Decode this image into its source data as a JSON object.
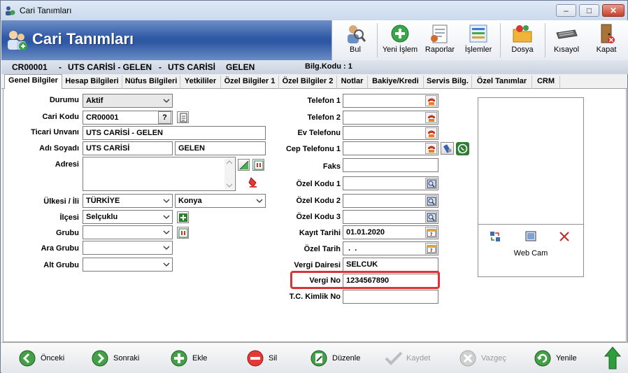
{
  "window": {
    "title": "Cari Tanımları"
  },
  "header": {
    "title": "Cari Tanımları"
  },
  "toolbar": {
    "bul": "Bul",
    "yeni_islem": "Yeni İşlem",
    "raporlar": "Raporlar",
    "islemler": "İşlemler",
    "dosya": "Dosya",
    "kisayol": "Kısayol",
    "kapat": "Kapat"
  },
  "infobar": {
    "code": "CR00001",
    "sep1": "-",
    "name1": "UTS CARİSİ - GELEN",
    "sep2": "-",
    "name2": "UTS CARİSİ",
    "name3": "GELEN",
    "bilg_kodu": "Bilg.Kodu : 1"
  },
  "tabs": [
    "Genel Bilgiler",
    "Hesap Bilgileri",
    "Nüfus Bilgileri",
    "Yetkililer",
    "Özel Bilgiler 1",
    "Özel Bilgiler 2",
    "Notlar",
    "Bakiye/Kredi",
    "Servis Bilg.",
    "Özel Tanımlar",
    "CRM"
  ],
  "left": {
    "durumu_label": "Durumu",
    "durumu_value": "Aktif",
    "cari_kodu_label": "Cari Kodu",
    "cari_kodu_value": "CR00001",
    "help": "?",
    "ticari_unvani_label": "Ticari Unvanı",
    "ticari_unvani_value": "UTS CARİSİ - GELEN",
    "adi_soyadi_label": "Adı Soyadı",
    "adi_value": "UTS CARİSİ",
    "soyadi_value": "GELEN",
    "adresi_label": "Adresi",
    "ulkesi_label": "Ülkesi / İli",
    "ulkesi_value": "TÜRKİYE",
    "ili_value": "Konya",
    "ilcesi_label": "İlçesi",
    "ilcesi_value": "Selçuklu",
    "grubu_label": "Grubu",
    "grubu_value": "",
    "ara_grubu_label": "Ara Grubu",
    "ara_grubu_value": "",
    "alt_grubu_label": "Alt Grubu",
    "alt_grubu_value": ""
  },
  "middle": {
    "telefon1_label": "Telefon 1",
    "telefon1_value": "",
    "telefon2_label": "Telefon 2",
    "telefon2_value": "",
    "ev_telefonu_label": "Ev Telefonu",
    "ev_telefonu_value": "",
    "cep_telefonu_label": "Cep Telefonu 1",
    "cep_telefonu_value": "",
    "faks_label": "Faks",
    "faks_value": "",
    "ozel_kodu1_label": "Özel Kodu 1",
    "ozel_kodu1_value": "",
    "ozel_kodu2_label": "Özel Kodu 2",
    "ozel_kodu2_value": "",
    "ozel_kodu3_label": "Özel Kodu 3",
    "ozel_kodu3_value": "",
    "kayit_tarihi_label": "Kayıt Tarihi",
    "kayit_tarihi_value": "01.01.2020",
    "ozel_tarih_label": "Özel Tarih",
    "ozel_tarih_value": " .  .",
    "vergi_dairesi_label": "Vergi Dairesi",
    "vergi_dairesi_value": "SELCUK",
    "vergi_no_label": "Vergi No",
    "vergi_no_value": "1234567890",
    "tc_kimlik_label": "T.C. Kimlik No",
    "tc_kimlik_value": ""
  },
  "photo": {
    "webcam_label": "Web Cam"
  },
  "bottom": {
    "onceki": "Önceki",
    "sonraki": "Sonraki",
    "ekle": "Ekle",
    "sil": "Sil",
    "duzenle": "Düzenle",
    "kaydet": "Kaydet",
    "vazgec": "Vazgeç",
    "yenile": "Yenile"
  },
  "colors": {
    "highlight": "#d9343a",
    "header_blue": "#2f58a5"
  }
}
